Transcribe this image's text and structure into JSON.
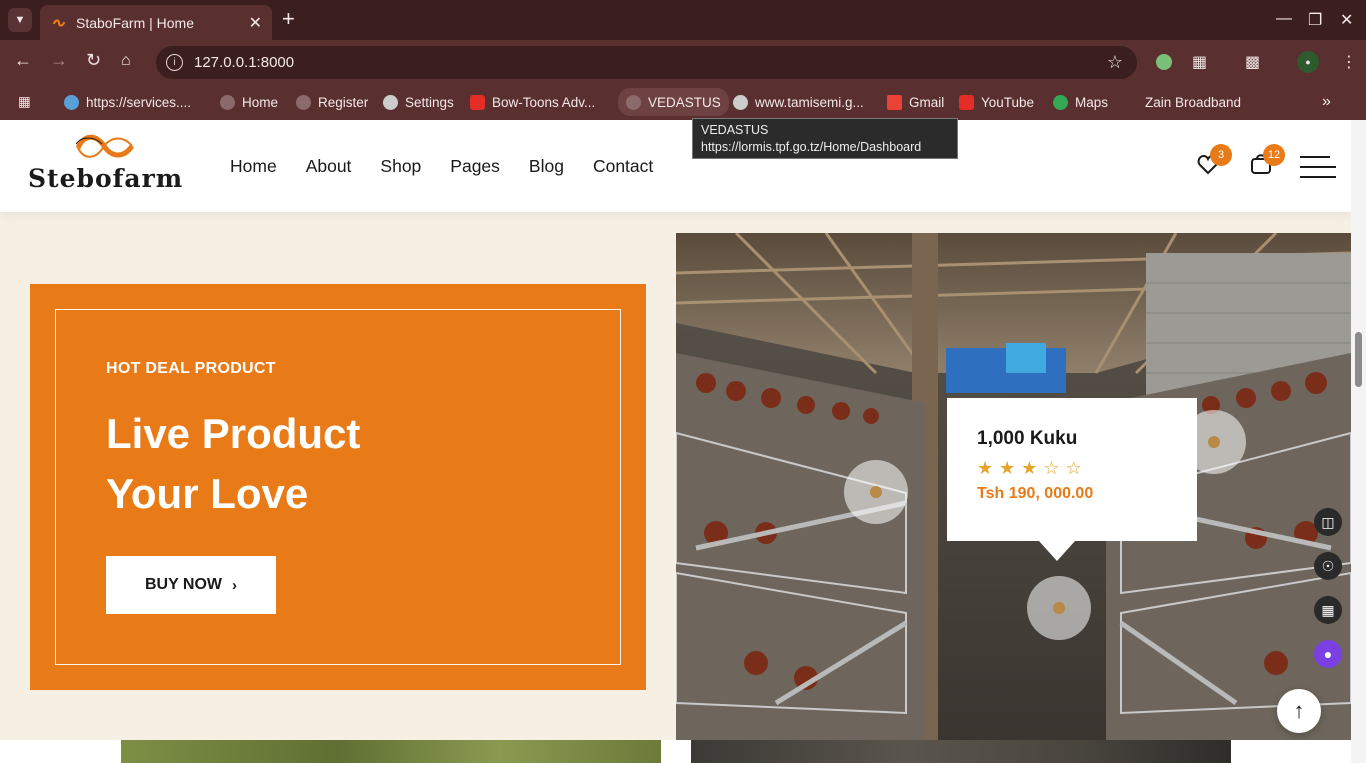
{
  "browser": {
    "tab_title": "StaboFarm | Home",
    "url": "127.0.0.1:8000",
    "bookmarks": [
      {
        "label": "https://services....",
        "icon": "globe-icon"
      },
      {
        "label": "Home",
        "icon": "user-icon"
      },
      {
        "label": "Register",
        "icon": "user-icon"
      },
      {
        "label": "Settings",
        "icon": "globe-icon"
      },
      {
        "label": "Bow-Toons Adv...",
        "icon": "youtube-icon"
      },
      {
        "label": "VEDASTUS",
        "icon": "user-icon"
      },
      {
        "label": "www.tamisemi.g...",
        "icon": "globe-icon"
      },
      {
        "label": "Gmail",
        "icon": "gmail-icon"
      },
      {
        "label": "YouTube",
        "icon": "youtube-icon"
      },
      {
        "label": "Maps",
        "icon": "maps-icon"
      },
      {
        "label": "Zain Broadband",
        "icon": ""
      }
    ],
    "tooltip": {
      "title": "VEDASTUS",
      "url": "https://lormis.tpf.go.tz/Home/Dashboard"
    }
  },
  "site": {
    "logo_text": "Stebofarm",
    "nav": [
      "Home",
      "About",
      "Shop",
      "Pages",
      "Blog",
      "Contact"
    ],
    "wishlist_count": "3",
    "cart_count": "12",
    "brand_color": "#e87a17"
  },
  "hero": {
    "kicker": "HOT DEAL PRODUCT",
    "title_line1": "Live Product",
    "title_line2": "Your Love",
    "button_label": "BUY NOW",
    "button_icon": "chevron-right-icon"
  },
  "product_card": {
    "name": "1,000 Kuku",
    "rating": 3,
    "rating_max": 5,
    "price": "Tsh 190, 000.00"
  }
}
